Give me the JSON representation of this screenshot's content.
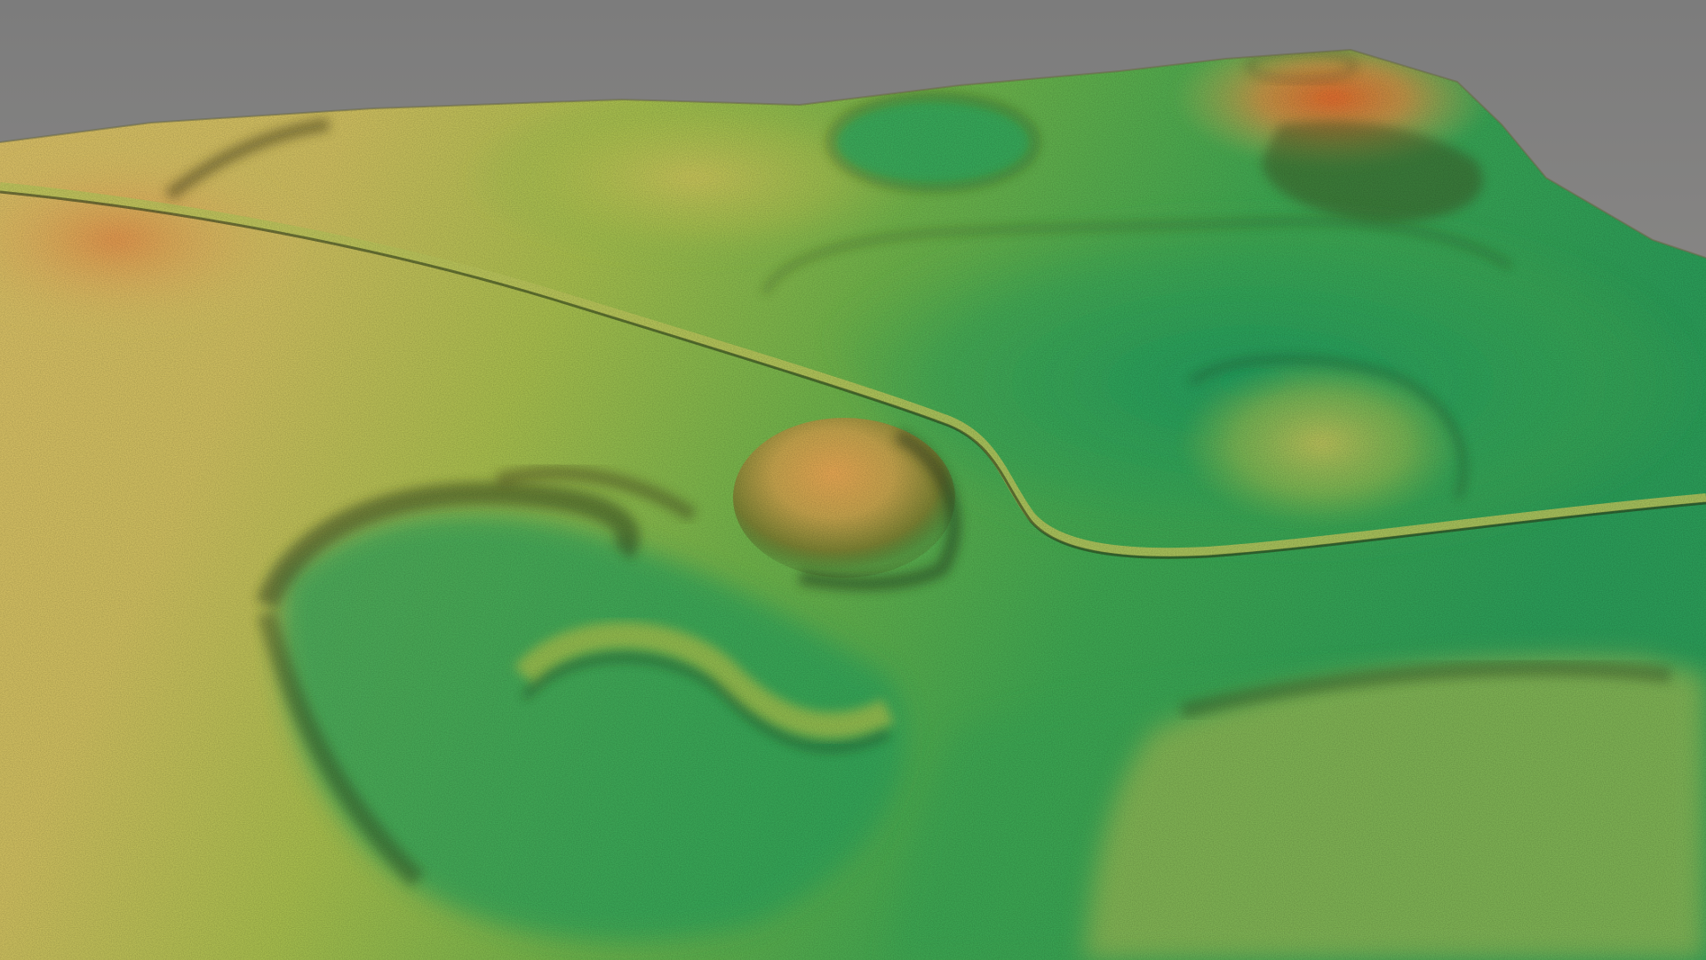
{
  "scene": {
    "kind": "3d-lidar-terrain-render",
    "labels_visible": false
  },
  "colors": {
    "background_top": "#7c7c7c",
    "background_bottom": "#a09c97",
    "elevation_low": "#1f9a5c",
    "elevation_mid_low": "#55b04a",
    "elevation_mid": "#a8be4e",
    "elevation_mid_high": "#d8be62",
    "elevation_high": "#e09a4a",
    "elevation_peak": "#e06a2c",
    "shadow": "#1c2a14"
  }
}
